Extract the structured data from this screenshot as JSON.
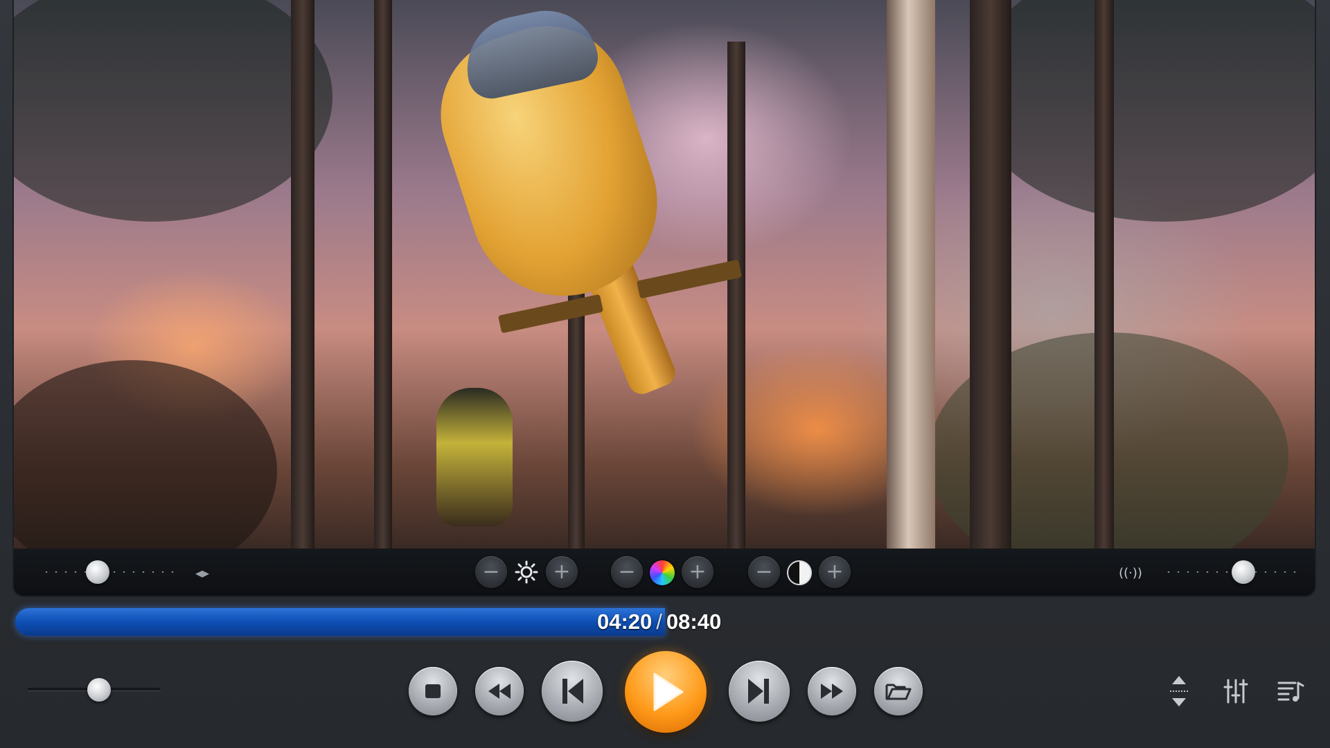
{
  "player": {
    "current_time": "04:20",
    "separator": "/",
    "total_time": "08:40",
    "progress_fraction": 0.5,
    "volume_fraction": 0.5,
    "balance_fraction": 0.5,
    "accent_color": "#ff9a1a",
    "seek_color": "#1a5fd0"
  },
  "adjust_bar": {
    "brightness": {
      "minus_icon": "minus-icon",
      "icon": "sun-icon",
      "plus_icon": "plus-icon"
    },
    "saturation": {
      "minus_icon": "minus-icon",
      "icon": "color-wheel-icon",
      "plus_icon": "plus-icon"
    },
    "contrast": {
      "minus_icon": "minus-icon",
      "icon": "contrast-icon",
      "plus_icon": "plus-icon"
    },
    "left_icon": "left-right-arrows-icon",
    "right_icon": "surround-sound-icon"
  },
  "controls": [
    {
      "name": "stop-button",
      "icon": "stop-icon"
    },
    {
      "name": "rewind-button",
      "icon": "rewind-icon"
    },
    {
      "name": "previous-button",
      "icon": "skip-previous-icon"
    },
    {
      "name": "play-button",
      "icon": "play-icon"
    },
    {
      "name": "next-button",
      "icon": "skip-next-icon"
    },
    {
      "name": "fast-forward-button",
      "icon": "fast-forward-icon"
    },
    {
      "name": "open-file-button",
      "icon": "folder-open-icon"
    }
  ],
  "side_controls": [
    {
      "name": "resize-button",
      "icon": "resize-vertical-icon"
    },
    {
      "name": "equalizer-button",
      "icon": "equalizer-icon"
    },
    {
      "name": "playlist-button",
      "icon": "playlist-icon"
    }
  ]
}
